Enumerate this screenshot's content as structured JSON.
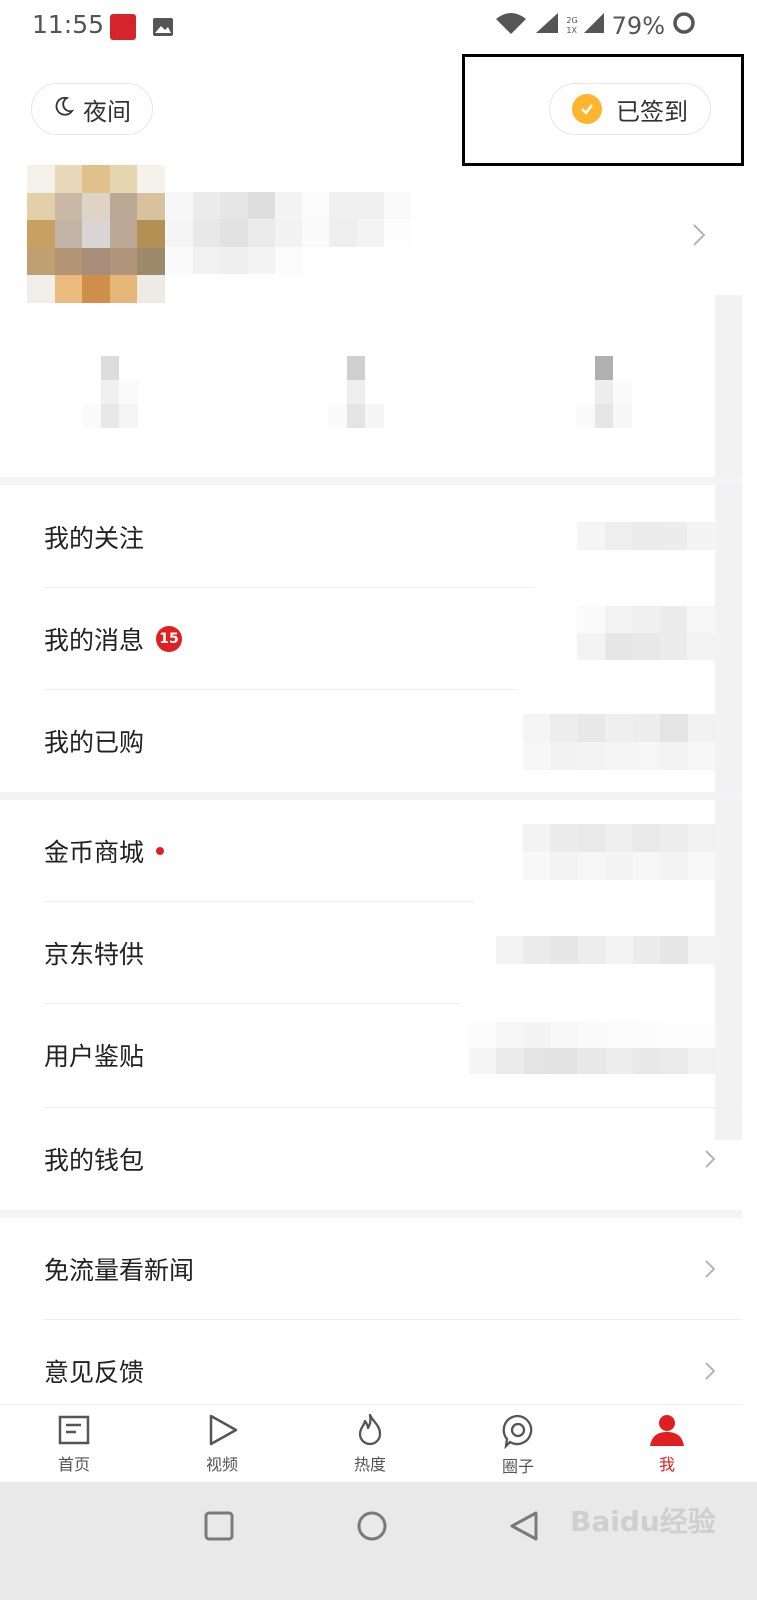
{
  "status_bar": {
    "time": "11:55",
    "network_2g": "2G",
    "network_1x": "1X",
    "battery": "79%"
  },
  "header": {
    "night_label": "夜间",
    "signed_label": "已签到"
  },
  "menu_groups": [
    {
      "items": [
        {
          "label": "我的关注"
        },
        {
          "label": "我的消息",
          "badge": "15"
        },
        {
          "label": "我的已购"
        }
      ]
    },
    {
      "items": [
        {
          "label": "金币商城",
          "dot": true
        },
        {
          "label": "京东特供"
        },
        {
          "label": "用户鉴贴"
        },
        {
          "label": "我的钱包"
        }
      ]
    },
    {
      "items": [
        {
          "label": "免流量看新闻"
        },
        {
          "label": "意见反馈"
        }
      ]
    }
  ],
  "bottom_nav": [
    {
      "label": "首页",
      "icon": "home-icon"
    },
    {
      "label": "视频",
      "icon": "video-icon"
    },
    {
      "label": "热度",
      "icon": "flame-icon"
    },
    {
      "label": "圈子",
      "icon": "circle-icon"
    },
    {
      "label": "我",
      "icon": "user-icon",
      "active": true
    }
  ],
  "watermark": "Baidu经验",
  "colors": {
    "accent": "#e02020",
    "coin": "#ffb52e",
    "section_gap": "#f4f4f6"
  }
}
